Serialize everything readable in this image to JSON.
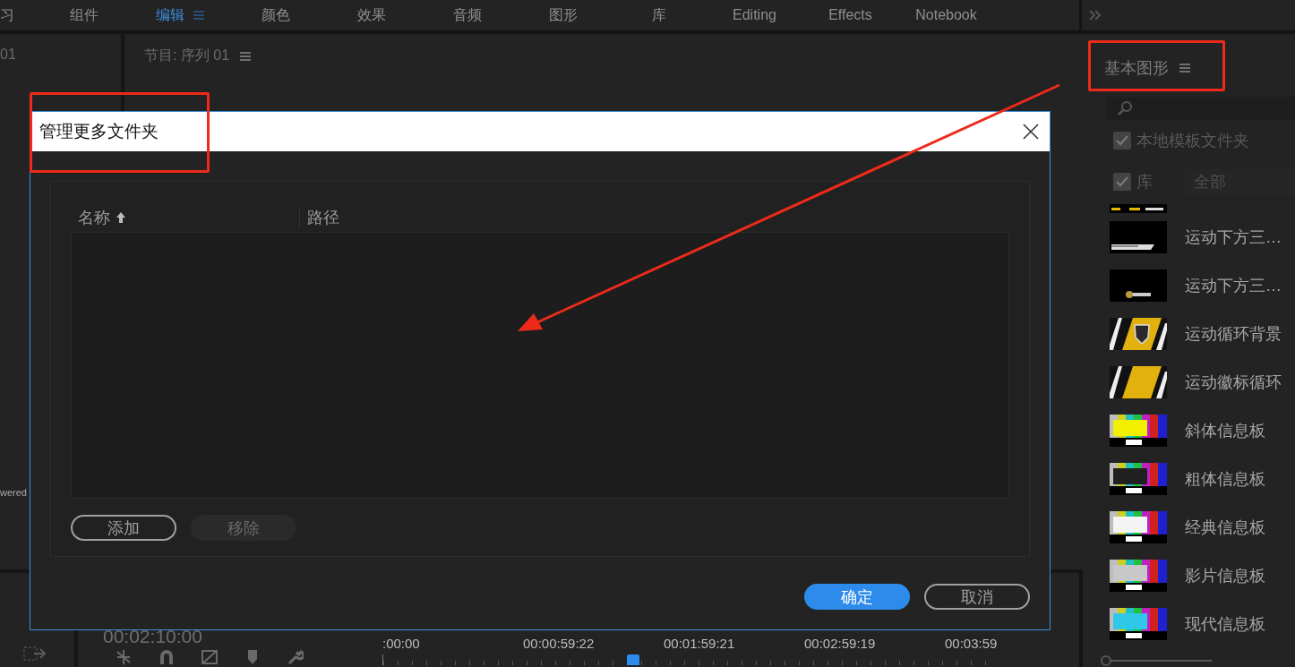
{
  "workspace_tabs": [
    {
      "label": "习",
      "selected": false
    },
    {
      "label": "组件",
      "selected": false
    },
    {
      "label": "编辑",
      "selected": true
    },
    {
      "label": "颜色",
      "selected": false
    },
    {
      "label": "效果",
      "selected": false
    },
    {
      "label": "音频",
      "selected": false
    },
    {
      "label": "图形",
      "selected": false
    },
    {
      "label": "库",
      "selected": false
    },
    {
      "label": "Editing",
      "selected": false
    },
    {
      "label": "Effects",
      "selected": false
    },
    {
      "label": "Notebook",
      "selected": false
    }
  ],
  "source_panel": {
    "title": "01",
    "side_text": "wered"
  },
  "program_panel": {
    "title": "节目: 序列 01"
  },
  "timeline": {
    "timecode": "00:02:10:00",
    "ruler": [
      ":00:00",
      "00:00:59:22",
      "00:01:59:21",
      "00:02:59:19",
      "00:03:59"
    ]
  },
  "essential_graphics": {
    "title": "基本图形",
    "local_templates": {
      "label": "本地模板文件夹",
      "checked": true
    },
    "libraries": {
      "label": "库",
      "checked": true,
      "value": "全部"
    },
    "templates": [
      {
        "kind": "strip"
      },
      {
        "label": "运动下方三…",
        "kind": "lower-third"
      },
      {
        "label": "运动下方三…",
        "kind": "lower-badge"
      },
      {
        "label": "运动循环背景",
        "kind": "gold-shield"
      },
      {
        "label": "运动徽标循环",
        "kind": "gold"
      },
      {
        "label": "斜体信息板",
        "kind": "bars-yellow"
      },
      {
        "label": "粗体信息板",
        "kind": "bars-dark"
      },
      {
        "label": "经典信息板",
        "kind": "bars-white"
      },
      {
        "label": "影片信息板",
        "kind": "bars-gray"
      },
      {
        "label": "现代信息板",
        "kind": "bars-cyan"
      }
    ],
    "thumbnail_size": {
      "level": 0
    }
  },
  "dialog": {
    "title": "管理更多文件夹",
    "columns": [
      {
        "label": "名称",
        "sorted": true
      },
      {
        "label": "路径",
        "sorted": false
      }
    ],
    "buttons": [
      {
        "label": "添加",
        "disabled": false
      },
      {
        "label": "移除",
        "disabled": true
      }
    ],
    "ok": "确定",
    "cancel": "取消"
  }
}
